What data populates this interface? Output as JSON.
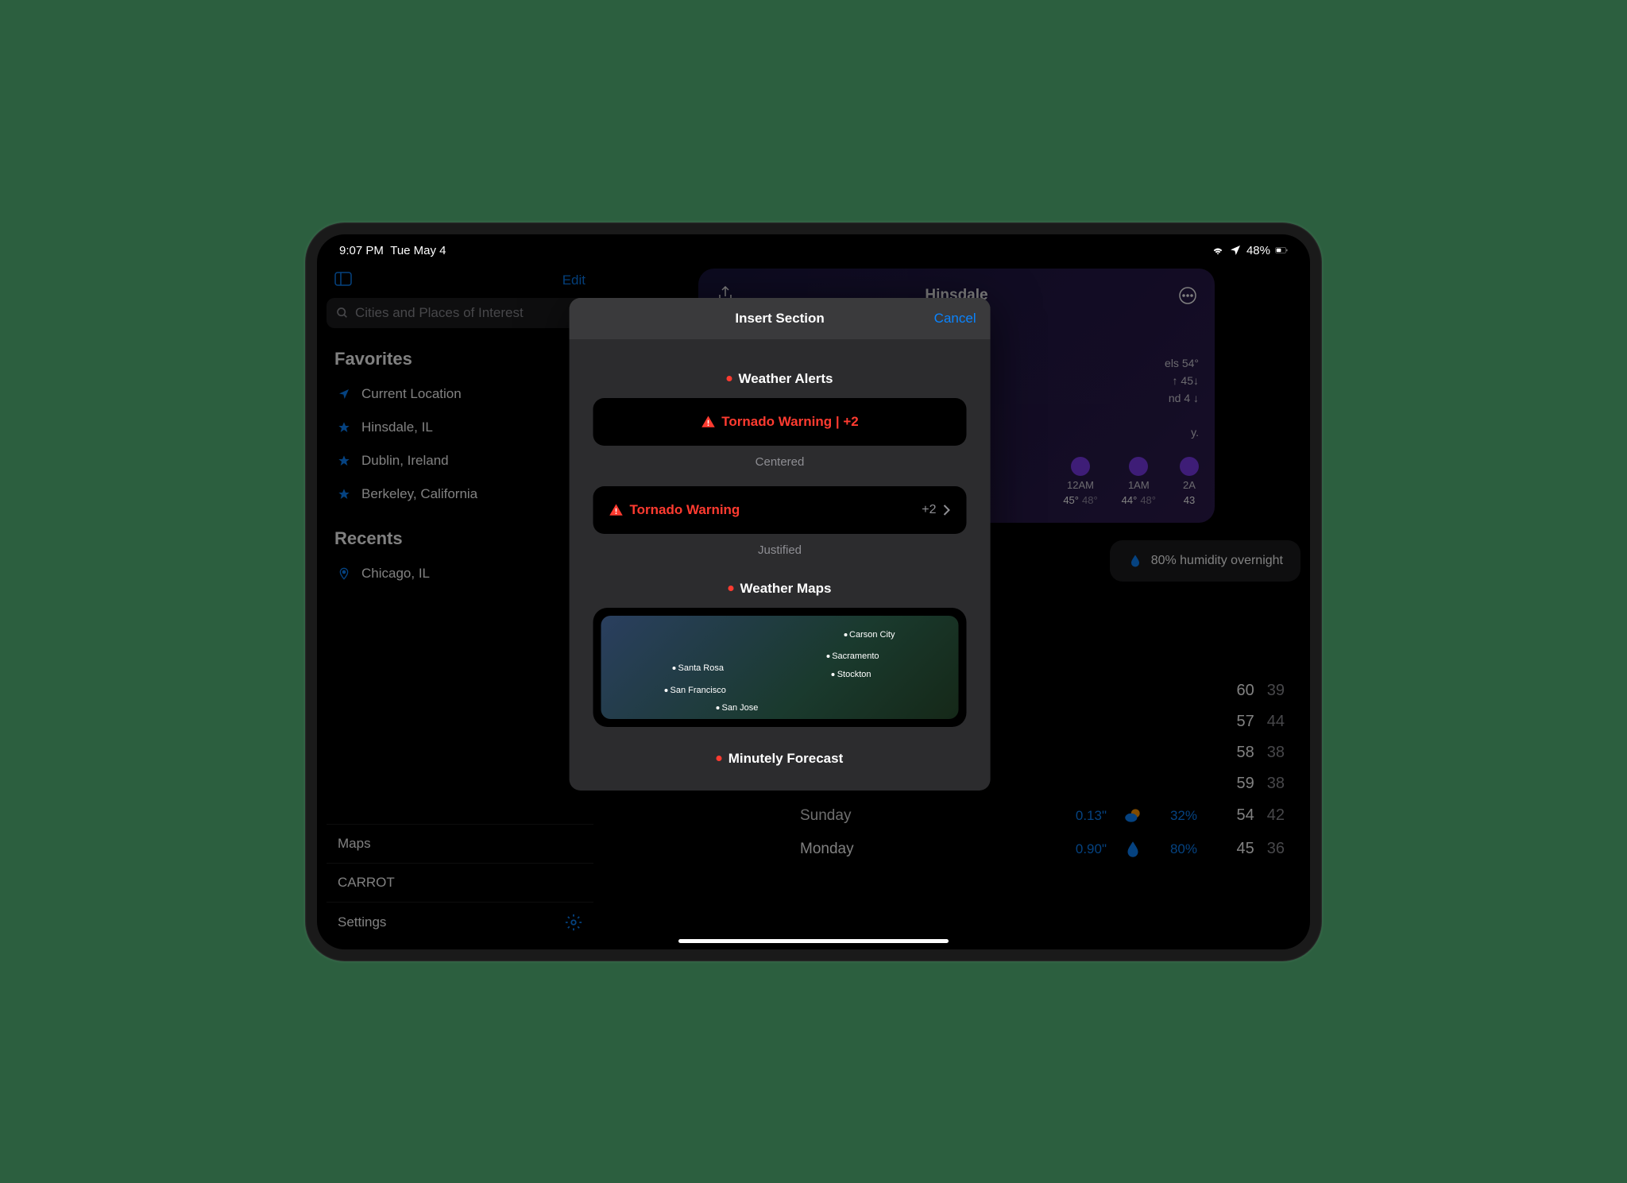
{
  "status": {
    "time": "9:07 PM",
    "date": "Tue May 4",
    "battery": "48%"
  },
  "sidebar": {
    "edit": "Edit",
    "search_placeholder": "Cities and Places of Interest",
    "favorites_header": "Favorites",
    "favorites": [
      {
        "label": "Current Location"
      },
      {
        "label": "Hinsdale, IL"
      },
      {
        "label": "Dublin, Ireland"
      },
      {
        "label": "Berkeley, California"
      }
    ],
    "recents_header": "Recents",
    "recents": [
      {
        "label": "Chicago, IL"
      }
    ],
    "bottom": {
      "maps": "Maps",
      "carrot": "CARROT",
      "settings": "Settings"
    }
  },
  "main": {
    "location": "Hinsdale",
    "details": [
      "els 54°",
      "↑ 45↓",
      "nd 4 ↓",
      "y."
    ],
    "hourly": [
      {
        "time": "12AM",
        "hi": "45°",
        "lo": "48°"
      },
      {
        "time": "1AM",
        "hi": "44°",
        "lo": "48°"
      },
      {
        "time": "2A",
        "hi": "43",
        "lo": ""
      }
    ],
    "humidity": "80% humidity overnight",
    "daily_extra": [
      {
        "hi": "60",
        "lo": "39"
      },
      {
        "hi": "57",
        "lo": "44"
      },
      {
        "hi": "58",
        "lo": "38"
      },
      {
        "hi": "59",
        "lo": "38"
      }
    ],
    "daily": [
      {
        "name": "Sunday",
        "precip": "0.13\"",
        "pct": "32%",
        "hi": "54",
        "lo": "42"
      },
      {
        "name": "Monday",
        "precip": "0.90\"",
        "pct": "80%",
        "hi": "45",
        "lo": "36"
      }
    ]
  },
  "modal": {
    "title": "Insert Section",
    "cancel": "Cancel",
    "weather_alerts": {
      "header": "Weather Alerts",
      "centered_text": "Tornado Warning | +2",
      "centered_caption": "Centered",
      "justified_text": "Tornado Warning",
      "justified_badge": "+2",
      "justified_caption": "Justified"
    },
    "weather_maps": {
      "header": "Weather Maps",
      "cities": [
        "Carson City",
        "Sacramento",
        "Santa Rosa",
        "Stockton",
        "San Francisco",
        "San Jose"
      ]
    },
    "minutely": {
      "header": "Minutely Forecast"
    }
  }
}
